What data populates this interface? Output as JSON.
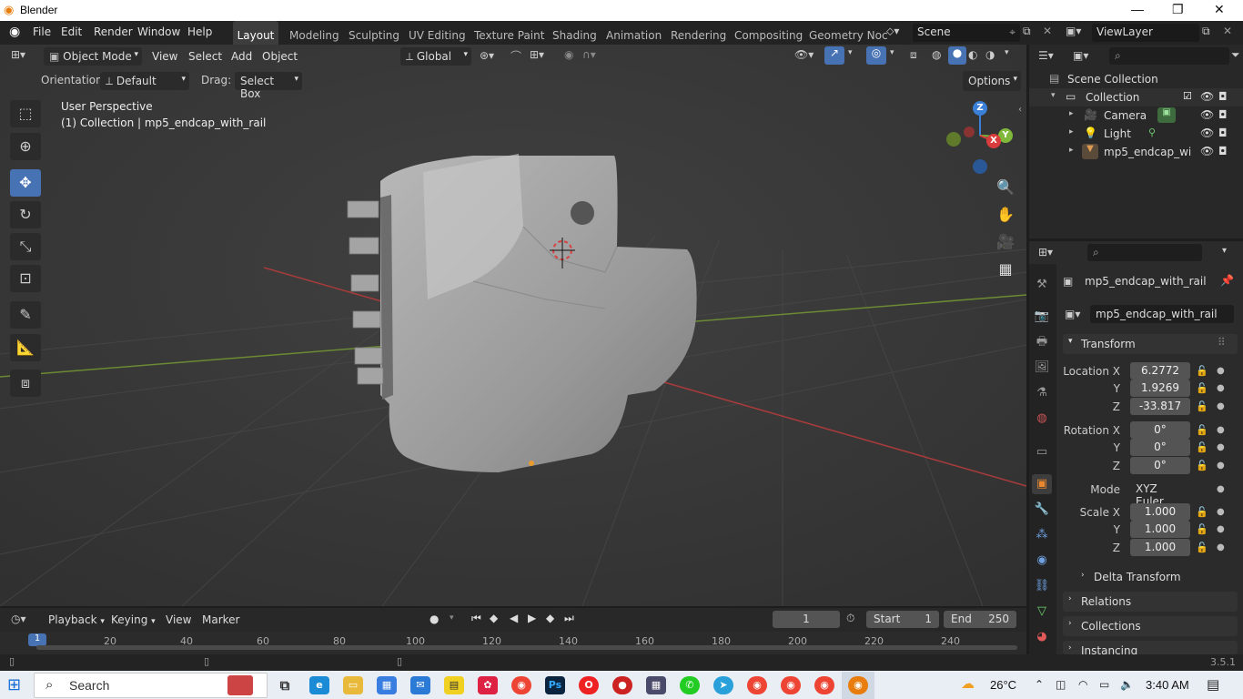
{
  "window": {
    "title": "Blender",
    "minimize": "—",
    "maximize": "❐",
    "close": "✕"
  },
  "menus": [
    "File",
    "Edit",
    "Render",
    "Window",
    "Help"
  ],
  "workspace_tabs": [
    "Layout",
    "Modeling",
    "Sculpting",
    "UV Editing",
    "Texture Paint",
    "Shading",
    "Animation",
    "Rendering",
    "Compositing",
    "Geometry Noc"
  ],
  "active_tab": "Layout",
  "scene": {
    "name": "Scene",
    "view_layer": "ViewLayer"
  },
  "viewport_header": {
    "mode": "Object Mode",
    "view": "View",
    "select": "Select",
    "add": "Add",
    "object": "Object",
    "transform_orientation": "Global",
    "orientation_label": "Orientation:",
    "orientation_value": "Default",
    "drag_label": "Drag:",
    "drag_value": "Select Box",
    "options": "Options"
  },
  "viewport": {
    "perspective": "User Perspective",
    "collection_info": "(1) Collection | mp5_endcap_with_rail"
  },
  "gizmo": {
    "z": "Z",
    "y": "Y",
    "x": "X"
  },
  "outliner": {
    "root": "Scene Collection",
    "collection": "Collection",
    "items": [
      {
        "name": "Camera",
        "icon": "camera-icon"
      },
      {
        "name": "Light",
        "icon": "light-icon"
      },
      {
        "name": "mp5_endcap_wi",
        "icon": "mesh-icon"
      }
    ]
  },
  "properties": {
    "object_name": "mp5_endcap_with_rail",
    "object_field": "mp5_endcap_with_rail",
    "transform_header": "Transform",
    "location": {
      "label_x": "Location X",
      "x": "6.2772",
      "y": "1.9269",
      "z": "-33.817"
    },
    "rotation": {
      "label_x": "Rotation X",
      "x": "0°",
      "y": "0°",
      "z": "0°"
    },
    "mode_label": "Mode",
    "mode_value": "XYZ Euler",
    "scale": {
      "label_x": "Scale X",
      "x": "1.000",
      "y": "1.000",
      "z": "1.000"
    },
    "axis_y": "Y",
    "axis_z": "Z",
    "delta_transform": "Delta Transform",
    "relations": "Relations",
    "collections": "Collections",
    "instancing": "Instancing"
  },
  "timeline": {
    "playback": "Playback",
    "keying": "Keying",
    "view": "View",
    "marker": "Marker",
    "current_frame": "1",
    "start_label": "Start",
    "start": "1",
    "end_label": "End",
    "end": "250",
    "ruler": [
      "1",
      "20",
      "40",
      "60",
      "80",
      "100",
      "120",
      "140",
      "160",
      "180",
      "200",
      "220",
      "240"
    ]
  },
  "status": {
    "version": "3.5.1"
  },
  "taskbar": {
    "search_placeholder": "Search",
    "weather": "26°C",
    "time": "3:40 AM"
  },
  "colors": {
    "accent": "#4772b3",
    "active_tab_bg": "#3d3d3d",
    "viewport_bg": "#3d3d3d",
    "x_axis": "#d83c3c",
    "y_axis": "#7fb83a",
    "z_axis": "#3a7fd8"
  }
}
